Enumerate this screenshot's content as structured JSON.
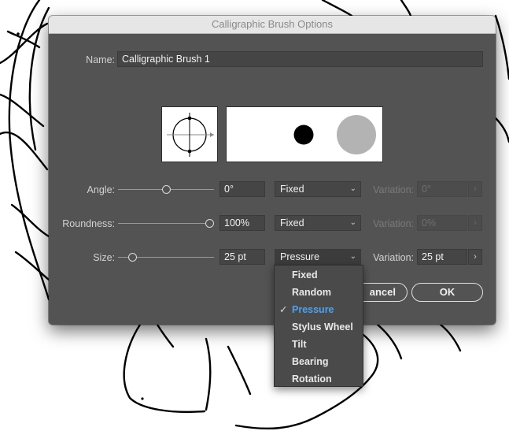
{
  "dialog": {
    "title": "Calligraphic Brush Options",
    "name_label": "Name:",
    "name_value": "Calligraphic Brush 1"
  },
  "rows": {
    "angle": {
      "label": "Angle:",
      "value": "0°",
      "mode": "Fixed",
      "variation_label": "Variation:",
      "variation_value": "0°",
      "slider_fraction": 0.5,
      "variation_enabled": false
    },
    "roundness": {
      "label": "Roundness:",
      "value": "100%",
      "mode": "Fixed",
      "variation_label": "Variation:",
      "variation_value": "0%",
      "slider_fraction": 1.0,
      "variation_enabled": false
    },
    "size": {
      "label": "Size:",
      "value": "25 pt",
      "mode": "Pressure",
      "variation_label": "Variation:",
      "variation_value": "25 pt",
      "slider_fraction": 0.08,
      "variation_enabled": true
    }
  },
  "dropdown_menu": {
    "items": [
      "Fixed",
      "Random",
      "Pressure",
      "Stylus Wheel",
      "Tilt",
      "Bearing",
      "Rotation"
    ],
    "selected": "Pressure",
    "check_glyph": "✓"
  },
  "buttons": {
    "cancel_label": "ancel",
    "ok_label": "OK"
  },
  "icons": {
    "chevron": "chevron-down-icon",
    "stepper": "chevron-right-icon",
    "check": "checkmark-icon"
  },
  "colors": {
    "dialog_bg": "#535353",
    "menu_selected": "#4ba3f0"
  }
}
